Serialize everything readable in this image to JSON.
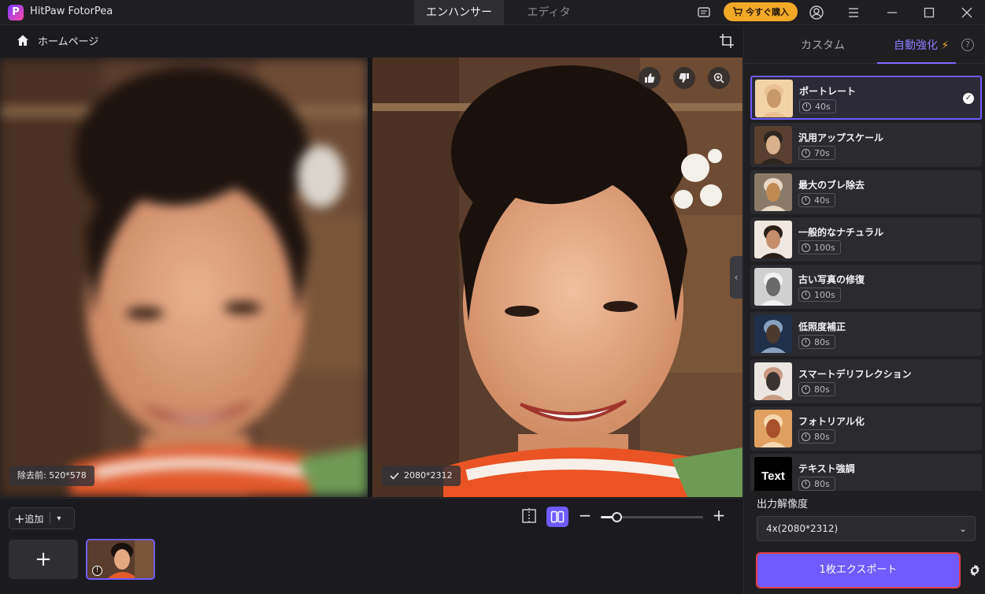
{
  "app": {
    "title": "HitPaw FotorPea",
    "logo_letter": "P"
  },
  "mode_tabs": [
    {
      "label": "エンハンサー",
      "active": true
    },
    {
      "label": "エディタ",
      "active": false
    }
  ],
  "header": {
    "buy_label": "今すぐ購入"
  },
  "breadcrumb": {
    "home_label": "ホームページ"
  },
  "left_pane": {
    "badge": "除去前: 520*578"
  },
  "right_pane": {
    "badge": "2080*2312"
  },
  "bottom": {
    "add_label": "追加",
    "zoom_level": 0.15
  },
  "panel": {
    "tabs": [
      {
        "label": "カスタム"
      },
      {
        "label": "自動強化"
      }
    ],
    "models": [
      {
        "name": "ポートレート",
        "time": "40s",
        "selected": true
      },
      {
        "name": "汎用アップスケール",
        "time": "70s"
      },
      {
        "name": "最大のブレ除去",
        "time": "40s"
      },
      {
        "name": "一般的なナチュラル",
        "time": "100s"
      },
      {
        "name": "古い写真の修復",
        "time": "100s"
      },
      {
        "name": "低照度補正",
        "time": "80s"
      },
      {
        "name": "スマートデリフレクション",
        "time": "80s"
      },
      {
        "name": "フォトリアル化",
        "time": "80s"
      },
      {
        "name": "テキスト強調",
        "time": "80s",
        "thumb_text": "Text"
      }
    ],
    "output_label": "出力解像度",
    "output_value": "4x(2080*2312)",
    "export_label": "1枚エクスポート"
  },
  "colors": {
    "accent": "#6f5bff",
    "buy": "#f2a928",
    "highlight": "#e0424b"
  }
}
